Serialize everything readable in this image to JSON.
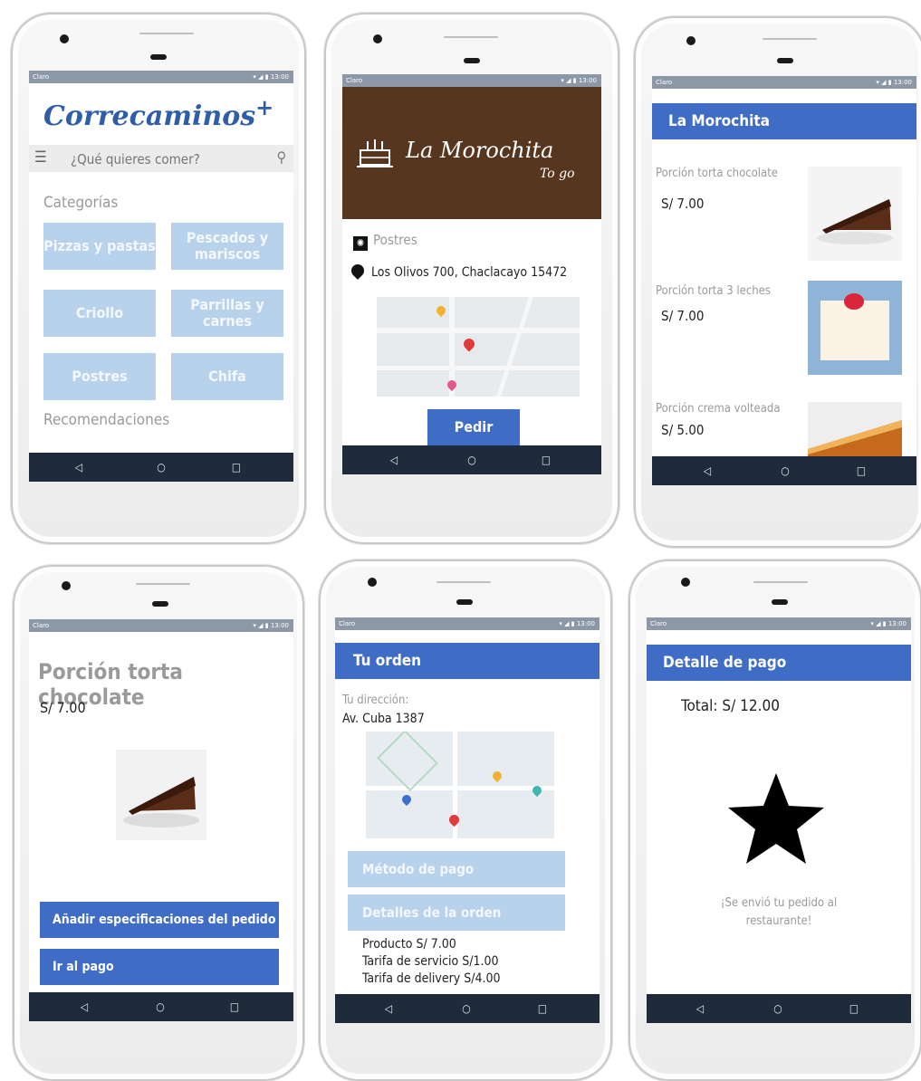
{
  "status": {
    "carrier": "Claro",
    "time": "13:00"
  },
  "nav": {
    "back": "◁",
    "home": "○",
    "recent": "□"
  },
  "screen1": {
    "logo": "Correcaminos",
    "logo_plus": "+",
    "search_placeholder": "¿Qué quieres comer?",
    "categories_title": "Categorías",
    "categories": [
      "Pizzas y pastas",
      "Pescados y mariscos",
      "Criollo",
      "Parrillas y carnes",
      "Postres",
      "Chifa"
    ],
    "recommendations_title": "Recomendaciones"
  },
  "screen2": {
    "banner_name": "La Morochita",
    "banner_sub": "To go",
    "category": "Postres",
    "address": "Los Olivos 700, Chaclacayo 15472",
    "order_button": "Pedir"
  },
  "screen3": {
    "title": "La Morochita",
    "products": [
      {
        "name": "Porción torta chocolate",
        "price": "S/ 7.00"
      },
      {
        "name": "Porción torta 3 leches",
        "price": "S/ 7.00"
      },
      {
        "name": "Porción crema volteada",
        "price": "S/ 5.00"
      }
    ]
  },
  "screen4": {
    "title": "Porción torta chocolate",
    "price": "S/ 7.00",
    "specs_button": "Añadir especificaciones del pedido",
    "pay_button": "Ir al pago"
  },
  "screen5": {
    "title": "Tu orden",
    "address_label": "Tu dirección:",
    "address": "Av. Cuba 1387",
    "payment_method": "Método de pago",
    "order_details": "Detalles de la orden",
    "lines": [
      "Producto S/ 7.00",
      "Tarifa de servicio S/1.00",
      "Tarifa de delivery S/4.00"
    ]
  },
  "screen6": {
    "title": "Detalle de pago",
    "total": "Total: S/ 12.00",
    "message": "¡Se envió tu pedido al restaurante!"
  },
  "colors": {
    "accent": "#3f6cc4",
    "tile": "#b9d2ec",
    "navbar": "#1f2a3a",
    "banner": "#56361f"
  }
}
